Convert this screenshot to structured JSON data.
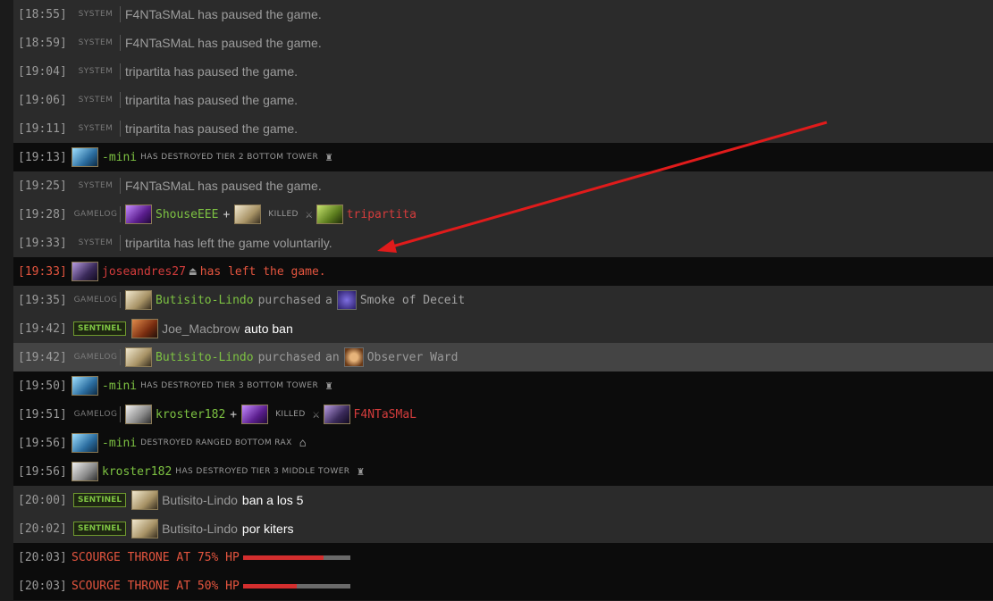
{
  "rows": [
    {
      "ts": "[18:55]",
      "tag": "SYSTEM",
      "text": "F4NTaSMaL has paused the game."
    },
    {
      "ts": "[18:59]",
      "tag": "SYSTEM",
      "text": "F4NTaSMaL has paused the game."
    },
    {
      "ts": "[19:04]",
      "tag": "SYSTEM",
      "text": "tripartita has paused the game."
    },
    {
      "ts": "[19:06]",
      "tag": "SYSTEM",
      "text": "tripartita has paused the game."
    },
    {
      "ts": "[19:11]",
      "tag": "SYSTEM",
      "text": "tripartita has paused the game."
    },
    {
      "ts": "[19:13]",
      "player": "-mini",
      "event": "HAS DESTROYED TIER 2 BOTTOM TOWER"
    },
    {
      "ts": "[19:25]",
      "tag": "SYSTEM",
      "text": "F4NTaSMaL has paused the game."
    },
    {
      "ts": "[19:28]",
      "tag": "GAMELOG",
      "killer": "ShouseEEE",
      "plus": "+",
      "action": "KILLED",
      "victim": "tripartita"
    },
    {
      "ts": "[19:33]",
      "tag": "SYSTEM",
      "text": "tripartita has left the game voluntarily."
    },
    {
      "ts": "[19:33]",
      "player": "joseandres27",
      "text": "has left the game."
    },
    {
      "ts": "[19:35]",
      "tag": "GAMELOG",
      "player": "Butisito-Lindo",
      "verb": "purchased",
      "article": "a",
      "item": "Smoke of Deceit"
    },
    {
      "ts": "[19:42]",
      "badge": "SENTINEL",
      "player": "Joe_Macbrow",
      "msg": "auto ban"
    },
    {
      "ts": "[19:42]",
      "tag": "GAMELOG",
      "player": "Butisito-Lindo",
      "verb": "purchased",
      "article": "an",
      "item": "Observer Ward"
    },
    {
      "ts": "[19:50]",
      "player": "-mini",
      "event": "HAS DESTROYED TIER 3 BOTTOM TOWER"
    },
    {
      "ts": "[19:51]",
      "tag": "GAMELOG",
      "killer": "kroster182",
      "plus": "+",
      "action": "KILLED",
      "victim": "F4NTaSMaL"
    },
    {
      "ts": "[19:56]",
      "player": "-mini",
      "event": "DESTROYED RANGED BOTTOM RAX"
    },
    {
      "ts": "[19:56]",
      "player": "kroster182",
      "event": "HAS DESTROYED TIER 3 MIDDLE TOWER"
    },
    {
      "ts": "[20:00]",
      "badge": "SENTINEL",
      "player": "Butisito-Lindo",
      "msg": "ban a los 5"
    },
    {
      "ts": "[20:02]",
      "badge": "SENTINEL",
      "player": "Butisito-Lindo",
      "msg": "por kiters"
    },
    {
      "ts": "[20:03]",
      "text": "SCOURGE THRONE AT 75% HP",
      "hp": 0.75
    },
    {
      "ts": "[20:03]",
      "text": "SCOURGE THRONE AT 50% HP",
      "hp": 0.5
    }
  ],
  "colors": {
    "green": "#7dc242",
    "red": "#d43c3c",
    "arrow": "#e01b1b"
  }
}
